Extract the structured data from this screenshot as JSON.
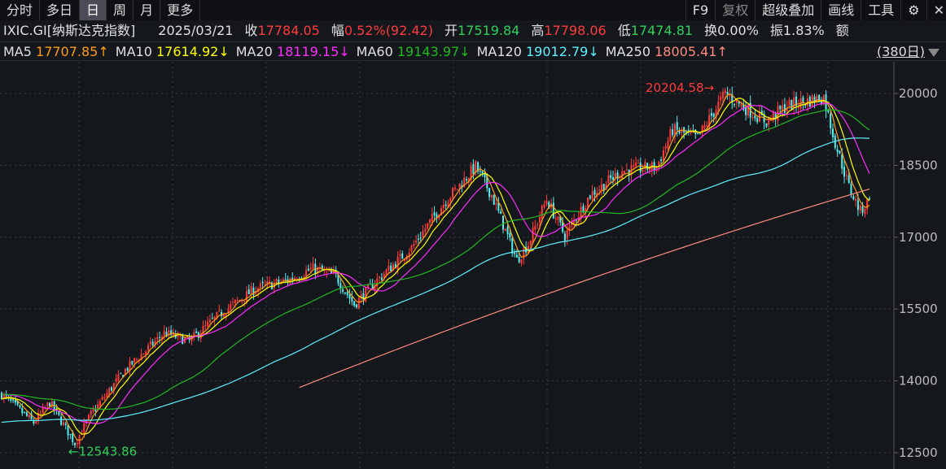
{
  "toolbar": {
    "tabs": [
      "分时",
      "多日",
      "日",
      "周",
      "月",
      "更多"
    ],
    "active": 2,
    "right": [
      "F9",
      "复权",
      "超级叠加",
      "画线",
      "工具"
    ]
  },
  "info": {
    "symbol": "IXIC.GI[纳斯达克指数]",
    "date": "2025/03/21",
    "close_label": "收",
    "close": "17784.05",
    "change_label": "幅",
    "change": "0.52%(92.42)",
    "open_label": "开",
    "open": "17519.84",
    "high_label": "高",
    "high": "17798.06",
    "low_label": "低",
    "low": "17474.81",
    "turnover_label": "换",
    "turnover": "0.00%",
    "amplitude_label": "振",
    "amplitude": "1.83%",
    "amount_label": "额"
  },
  "ma": [
    {
      "name": "MA5",
      "value": "17707.85↑",
      "color": "#ff9c1a"
    },
    {
      "name": "MA10",
      "value": "17614.92↓",
      "color": "#ffff00"
    },
    {
      "name": "MA20",
      "value": "18119.15↓",
      "color": "#ff2cff"
    },
    {
      "name": "MA60",
      "value": "19143.97↓",
      "color": "#22b822"
    },
    {
      "name": "MA120",
      "value": "19012.79↓",
      "color": "#5ef0ff"
    },
    {
      "name": "MA250",
      "value": "18005.41↑",
      "color": "#ff8a80"
    }
  ],
  "period": "(380日)",
  "chart_data": {
    "type": "candlestick",
    "days": 380,
    "ylim": [
      12300,
      20700
    ],
    "yticks": [
      12500,
      14000,
      15500,
      17000,
      18500,
      20000
    ],
    "close_keypoints": [
      [
        0,
        13720
      ],
      [
        14,
        13130
      ],
      [
        21,
        13550
      ],
      [
        32,
        12700
      ],
      [
        39,
        13300
      ],
      [
        54,
        14230
      ],
      [
        71,
        15000
      ],
      [
        82,
        14830
      ],
      [
        96,
        15420
      ],
      [
        111,
        15930
      ],
      [
        125,
        16100
      ],
      [
        136,
        16350
      ],
      [
        146,
        16180
      ],
      [
        154,
        15590
      ],
      [
        164,
        16100
      ],
      [
        179,
        16780
      ],
      [
        193,
        17710
      ],
      [
        207,
        18470
      ],
      [
        214,
        17880
      ],
      [
        225,
        16520
      ],
      [
        230,
        16860
      ],
      [
        238,
        17790
      ],
      [
        246,
        17030
      ],
      [
        257,
        17880
      ],
      [
        271,
        18390
      ],
      [
        286,
        18470
      ],
      [
        293,
        19240
      ],
      [
        304,
        19070
      ],
      [
        316,
        20000
      ],
      [
        323,
        19750
      ],
      [
        334,
        19410
      ],
      [
        343,
        19750
      ],
      [
        359,
        19920
      ],
      [
        364,
        18980
      ],
      [
        370,
        18050
      ],
      [
        375,
        17540
      ],
      [
        379,
        17784.05
      ]
    ],
    "ma120_start": 13130,
    "ma60_start": 13720,
    "ma250": [
      [
        130,
        13860
      ],
      [
        379,
        18005.41
      ]
    ],
    "annotations": {
      "high": "20204.58",
      "low": "12543.86"
    },
    "colors": {
      "up": "#ff3b3b",
      "down": "#54f0f0"
    }
  }
}
